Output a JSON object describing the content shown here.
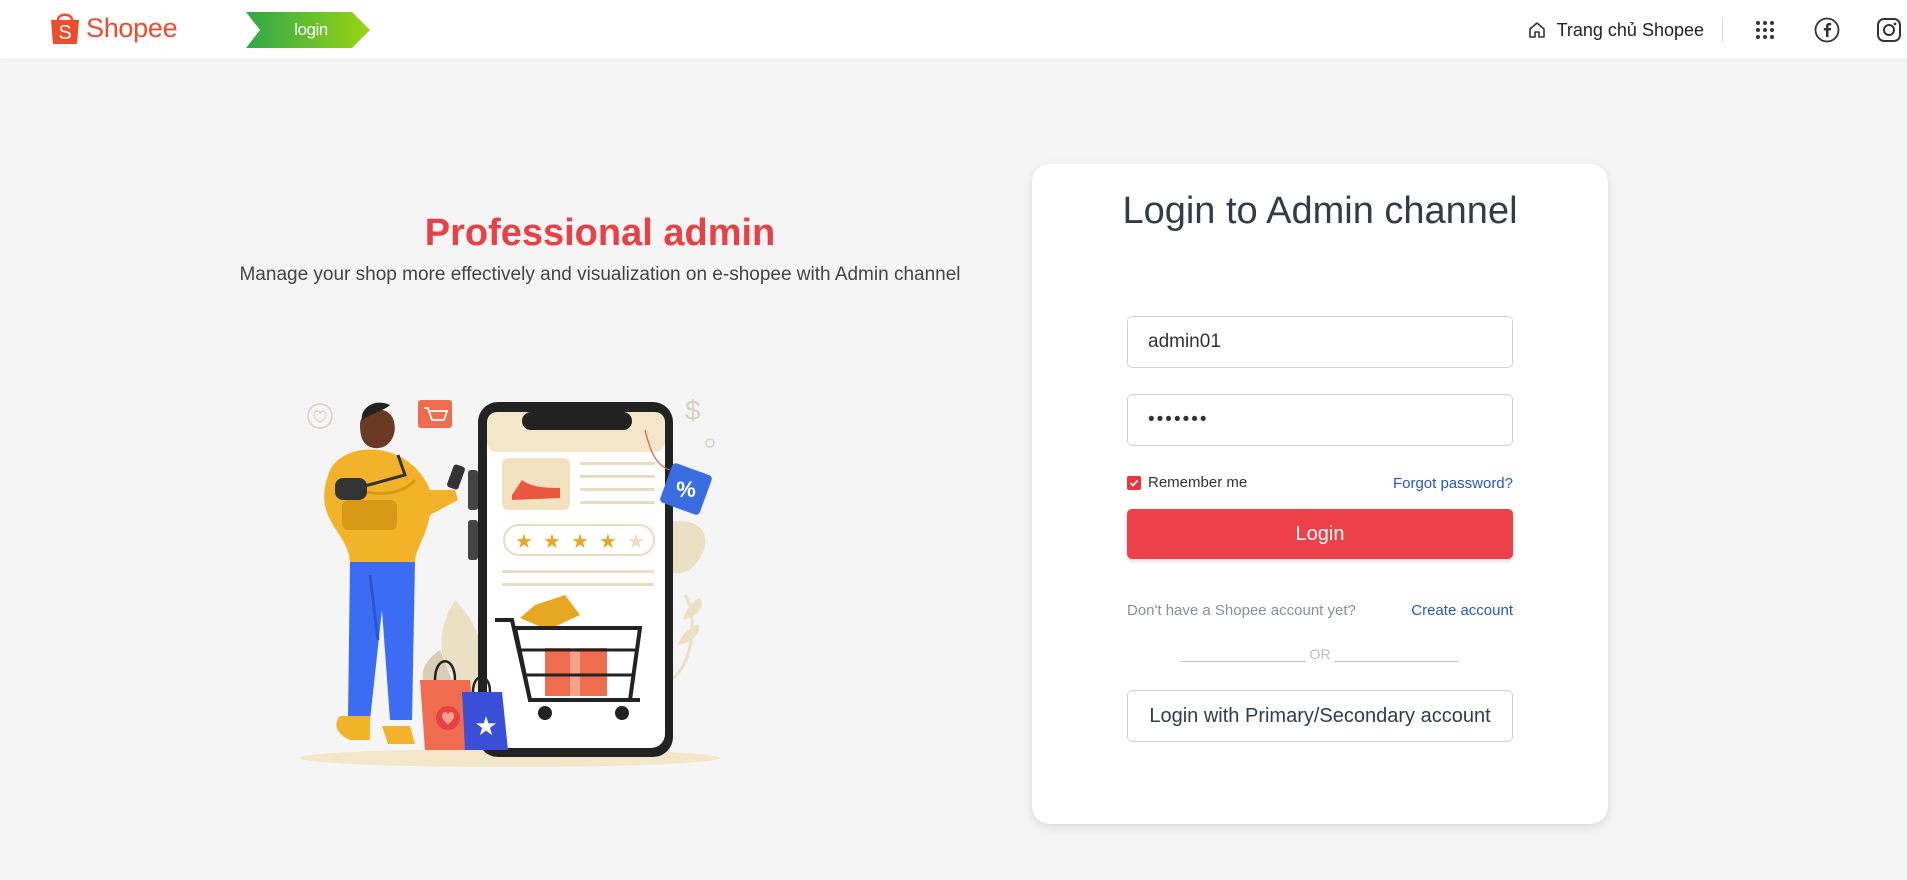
{
  "header": {
    "brand": "Shopee",
    "login_tag": "login",
    "home_link": "Trang chủ Shopee",
    "icons": [
      "home-icon",
      "apps-grid-icon",
      "facebook-icon",
      "instagram-icon"
    ]
  },
  "hero": {
    "title": "Professional admin",
    "subtitle": "Manage your shop more effectively and visualization on e-shopee with Admin channel"
  },
  "login_card": {
    "title": "Login to Admin channel",
    "username_value": "admin01",
    "password_value": "•••••••",
    "remember_label": "Remember me",
    "remember_checked": true,
    "forgot_label": "Forgot password?",
    "login_button": "Login",
    "no_account_text": "Don't have a Shopee account yet?",
    "create_account_label": "Create account",
    "or_text": "________________ OR ________________",
    "alt_login_button": "Login with Primary/Secondary account"
  },
  "colors": {
    "brand": "#ee4d2d",
    "accent": "#ee4048",
    "link": "#2457c5",
    "login_tag_start": "#2ea84a",
    "login_tag_end": "#9ad412"
  }
}
